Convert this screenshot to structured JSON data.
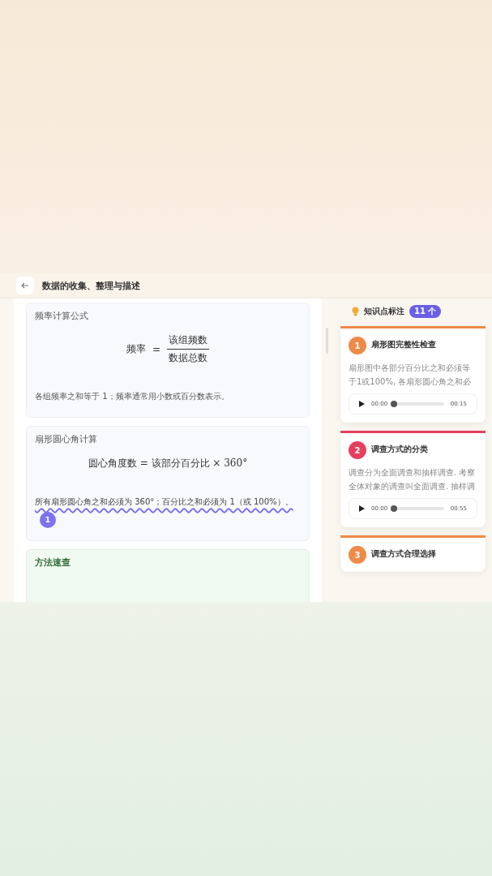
{
  "header": {
    "title": "数据的收集、整理与描述"
  },
  "sections": [
    {
      "kind": "fraction",
      "title": "频率计算公式",
      "lhs": "频率",
      "equals": "=",
      "numerator": "该组频数",
      "denominator": "数据总数",
      "note": "各组频率之和等于 1；频率通常用小数或百分数表示。"
    },
    {
      "kind": "inline",
      "title": "扇形圆心角计算",
      "formula": "圆心角度数 = 该部分百分比 × 360°",
      "note": "所有扇形圆心角之和必须为 360°；百分比之和必须为 1（或 100%）。",
      "marked": true,
      "badge": "1"
    },
    {
      "kind": "method",
      "title": "方法速查"
    }
  ],
  "annotations": {
    "title": "知识点标注",
    "count": "11 个",
    "cards": [
      {
        "number": "1",
        "title": "扇形图完整性检查",
        "color": "#ee8a47",
        "description": "扇形图中各部分百分比之和必须等于1或100%, 各扇形圆心角之和必",
        "player": {
          "current": "00:00",
          "duration": "00:15",
          "level": 0
        }
      },
      {
        "number": "2",
        "title": "调查方式的分类",
        "color": "#e6405e",
        "description": "调查分为全面调查和抽样调查. 考察全体对象的调查叫全面调查. 抽样调",
        "player": {
          "current": "00:00",
          "duration": "00:55",
          "level": 0
        }
      },
      {
        "number": "3",
        "title": "调查方式合理选择",
        "color": "#ee8a47"
      }
    ]
  }
}
